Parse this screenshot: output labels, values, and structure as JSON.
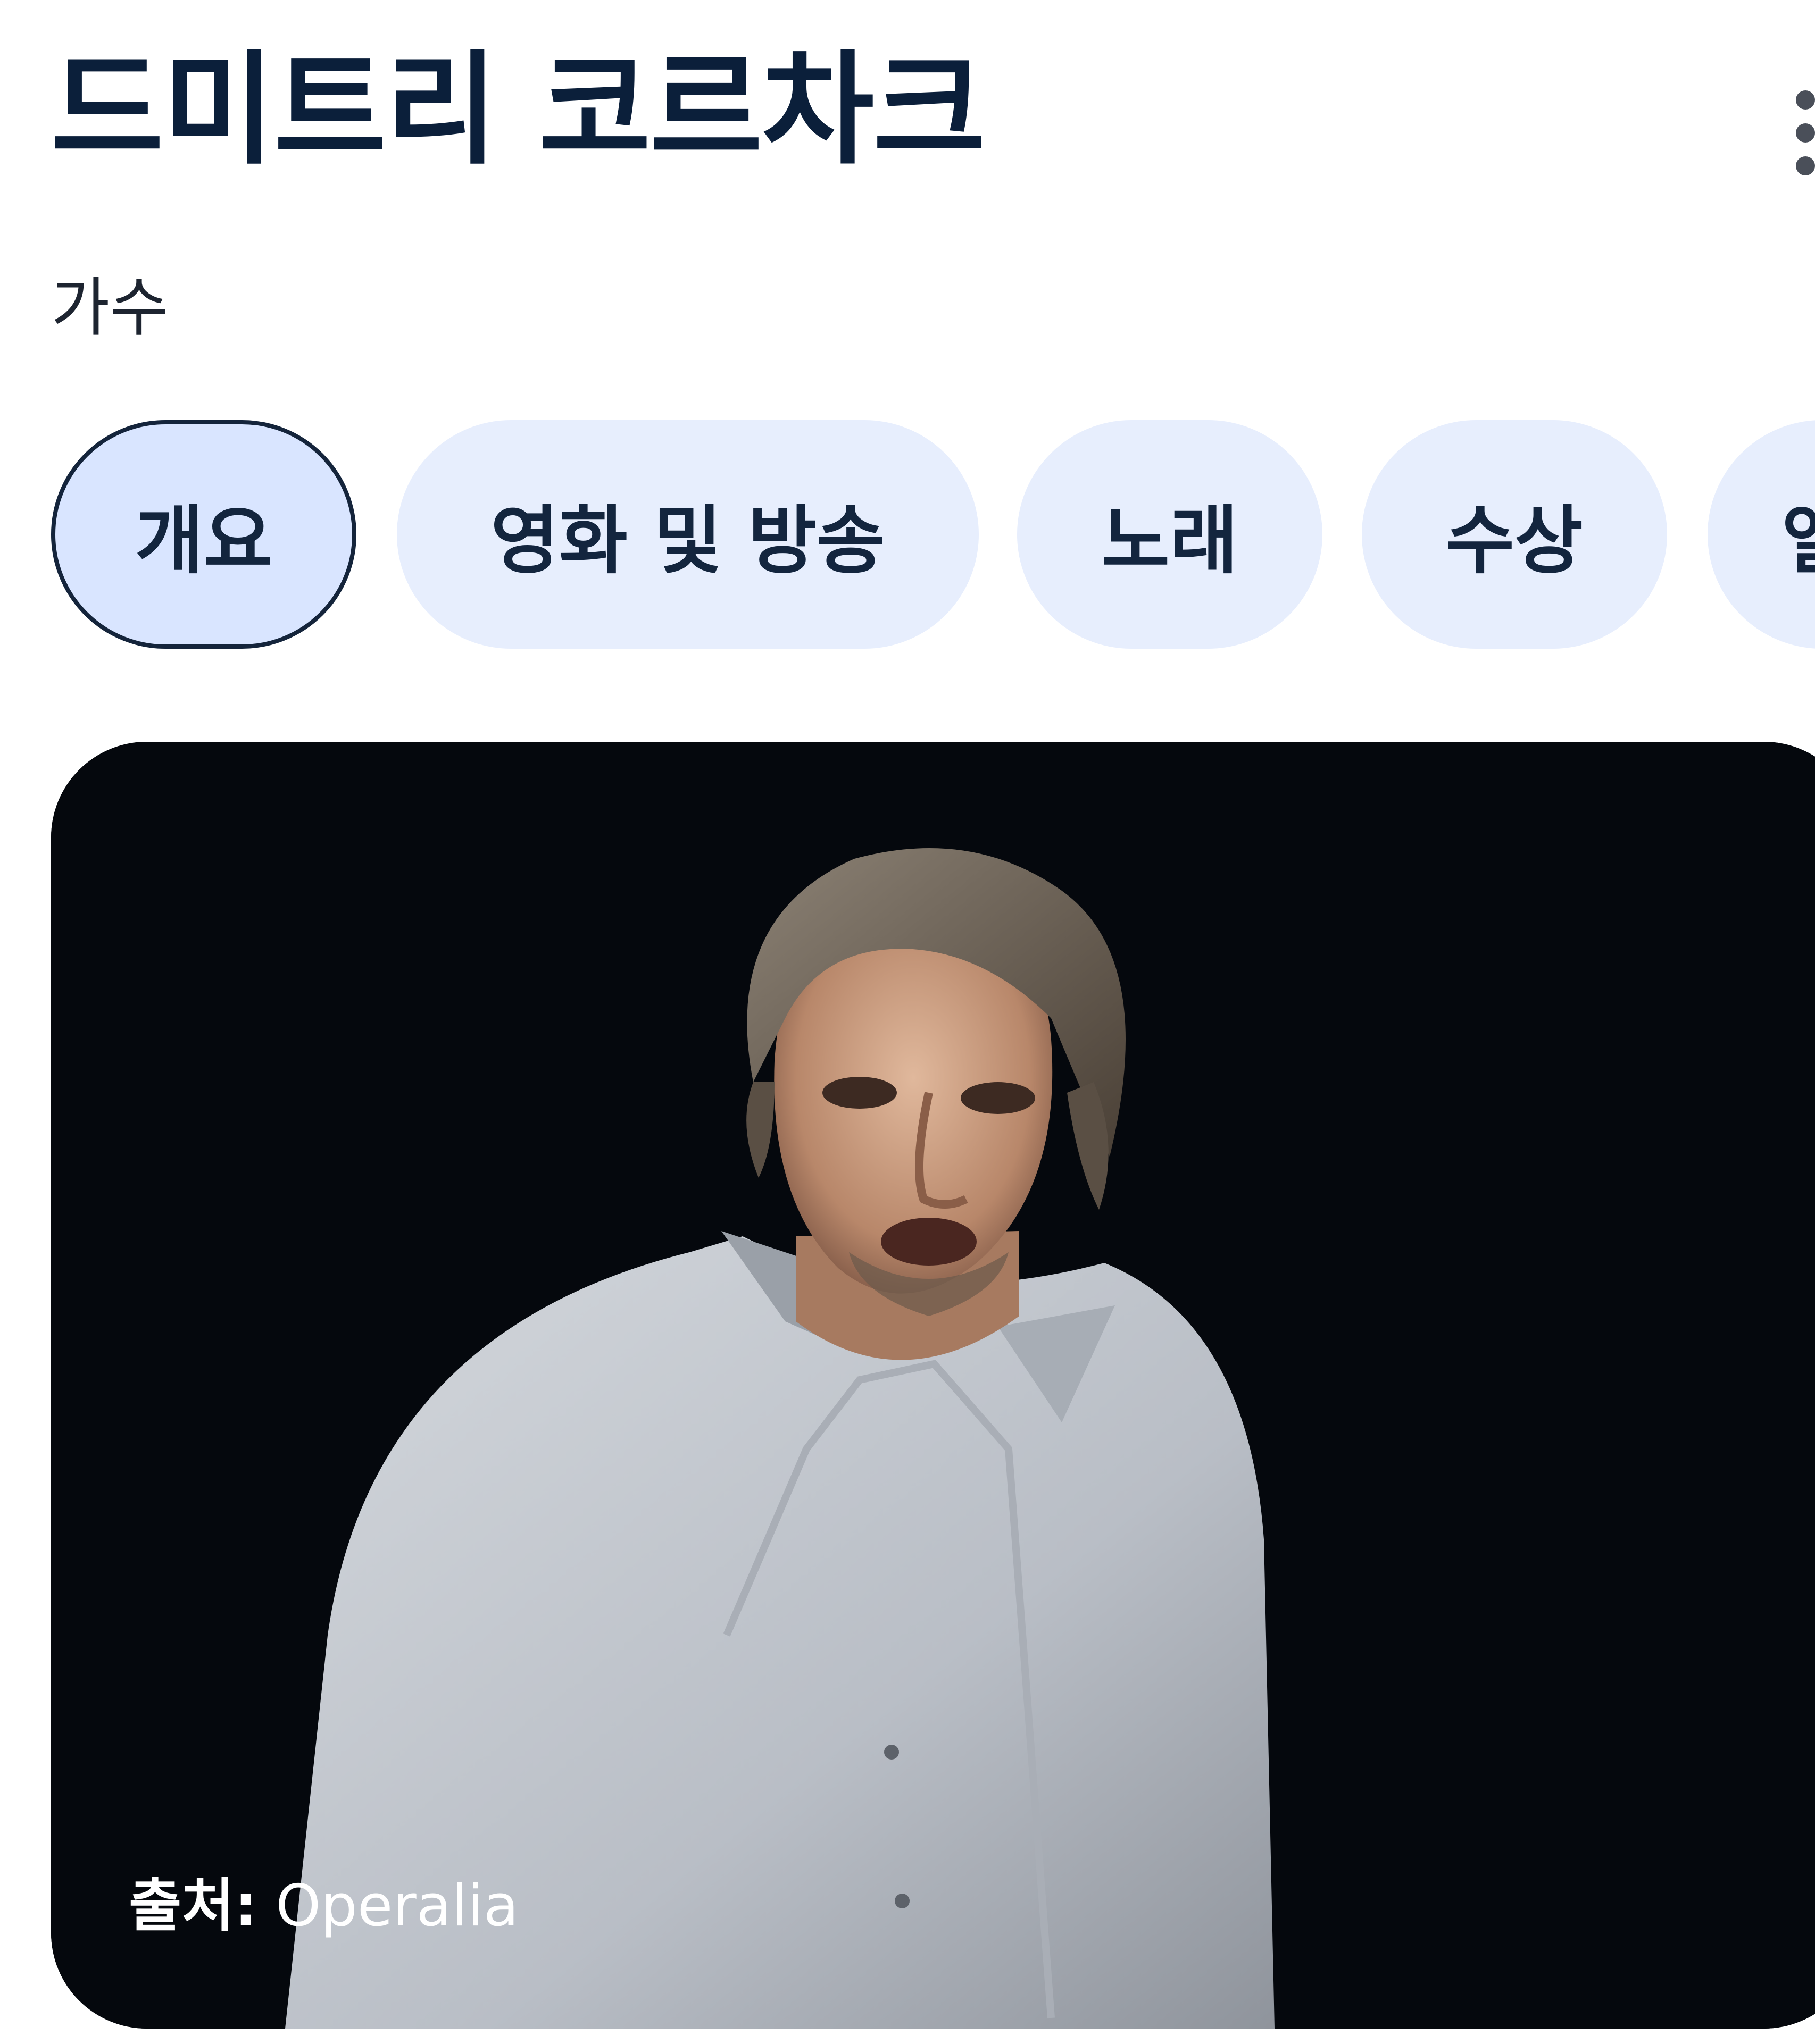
{
  "header": {
    "title": "드미트리 코르차크",
    "subtitle": "가수"
  },
  "tabs": [
    {
      "label": "개요",
      "active": true
    },
    {
      "label": "영화 및 방송",
      "active": false
    },
    {
      "label": "노래",
      "active": false
    },
    {
      "label": "수상",
      "active": false
    },
    {
      "label": "앨",
      "active": false
    }
  ],
  "photo": {
    "caption_label": "출처:",
    "caption_source": "Operalia"
  },
  "icons": {
    "more": "more-vert-icon"
  },
  "colors": {
    "title": "#0b1f3a",
    "chip_bg": "#e7eefd",
    "chip_active_border": "#14243b",
    "photo_bg": "#05080d"
  }
}
